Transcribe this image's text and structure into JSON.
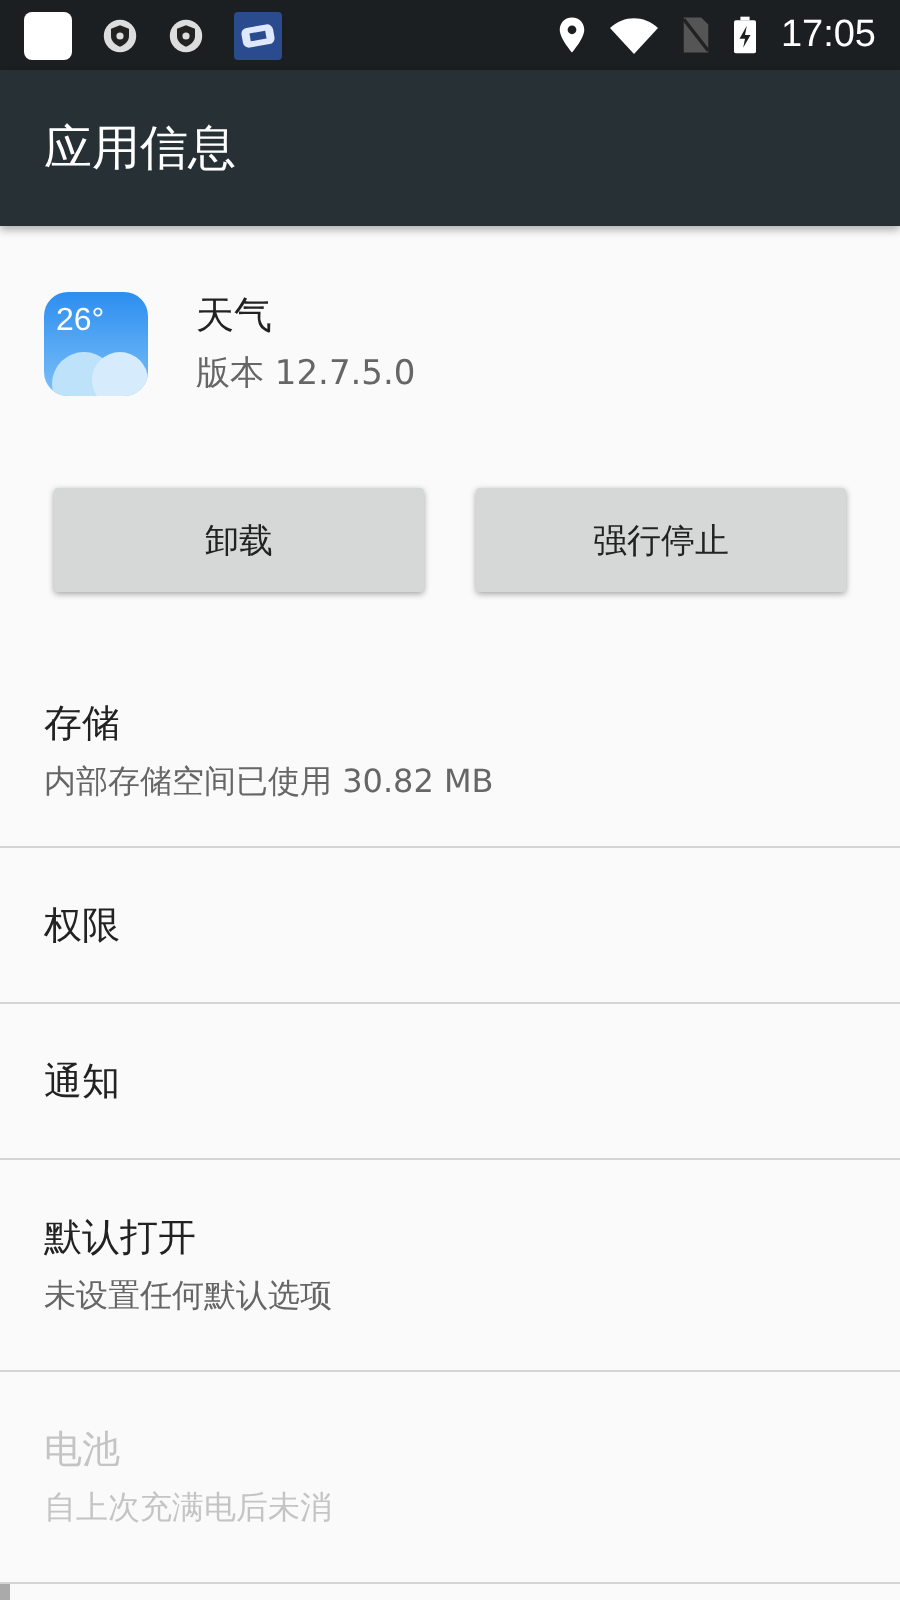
{
  "status_bar": {
    "time": "17:05"
  },
  "app_bar": {
    "title": "应用信息"
  },
  "app": {
    "name": "天气",
    "version": "版本 12.7.5.0",
    "icon_text": "26°"
  },
  "buttons": [
    "卸载",
    "强行停止"
  ],
  "items": [
    {
      "title": "存储",
      "subtitle": "内部存储空间已使用 30.82 MB",
      "disabled": false
    },
    {
      "title": "权限",
      "disabled": false
    },
    {
      "title": "通知",
      "disabled": false
    },
    {
      "title": "默认打开",
      "subtitle": "未设置任何默认选项",
      "disabled": false
    },
    {
      "title": "电池",
      "subtitle": "自上次充满电后未消",
      "disabled": true
    }
  ]
}
